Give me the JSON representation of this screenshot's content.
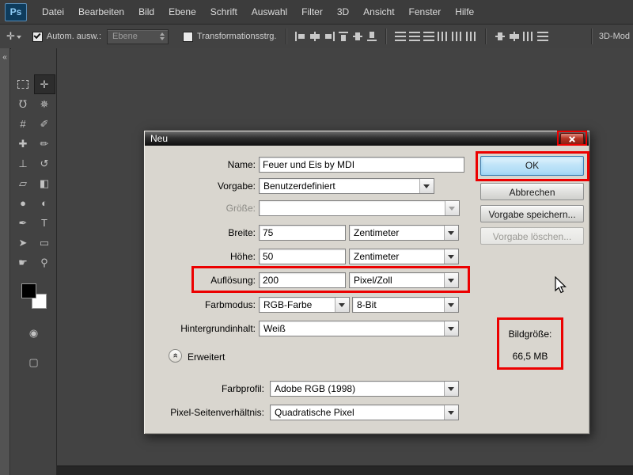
{
  "menubar": {
    "logo": "Ps",
    "items": [
      "Datei",
      "Bearbeiten",
      "Bild",
      "Ebene",
      "Schrift",
      "Auswahl",
      "Filter",
      "3D",
      "Ansicht",
      "Fenster",
      "Hilfe"
    ]
  },
  "optionsbar": {
    "tool_glyph": "✛",
    "auto_select_label": "Autom. ausw.:",
    "auto_select_value": "Ebene",
    "transform_label": "Transformationsstrg.",
    "workspace_label": "3D-Mod"
  },
  "toolbar": {
    "collapse_glyph": "«",
    "tools": [
      {
        "name": "rectangular-marquee",
        "glyph": "",
        "dashed": true
      },
      {
        "name": "move",
        "glyph": "✛",
        "selected": true
      },
      {
        "name": "lasso",
        "glyph": "℧"
      },
      {
        "name": "quick-selection",
        "glyph": "✵"
      },
      {
        "name": "crop",
        "glyph": "#"
      },
      {
        "name": "eyedropper",
        "glyph": "✐"
      },
      {
        "name": "healing-brush",
        "glyph": "✚"
      },
      {
        "name": "brush",
        "glyph": "✏"
      },
      {
        "name": "clone-stamp",
        "glyph": "⊥"
      },
      {
        "name": "history-brush",
        "glyph": "↺"
      },
      {
        "name": "eraser",
        "glyph": "▱"
      },
      {
        "name": "gradient",
        "glyph": "◧"
      },
      {
        "name": "blur",
        "glyph": "●"
      },
      {
        "name": "dodge",
        "glyph": "◐"
      },
      {
        "name": "pen",
        "glyph": "✒"
      },
      {
        "name": "type",
        "glyph": "T"
      },
      {
        "name": "path-selection",
        "glyph": "➤"
      },
      {
        "name": "shape",
        "glyph": "▭"
      },
      {
        "name": "hand",
        "glyph": "☛"
      },
      {
        "name": "zoom",
        "glyph": "⚲"
      }
    ],
    "extra_tools": [
      {
        "name": "quick-mask",
        "glyph": "◉"
      },
      {
        "name": "screen-mode",
        "glyph": "▢"
      }
    ]
  },
  "dialog": {
    "title": "Neu",
    "name_label": "Name:",
    "name_value": "Feuer und Eis by MDI",
    "preset_label": "Vorgabe:",
    "preset_value": "Benutzerdefiniert",
    "size_label": "Größe:",
    "width_label": "Breite:",
    "width_value": "75",
    "width_unit": "Zentimeter",
    "height_label": "Höhe:",
    "height_value": "50",
    "height_unit": "Zentimeter",
    "resolution_label": "Auflösung:",
    "resolution_value": "200",
    "resolution_unit": "Pixel/Zoll",
    "mode_label": "Farbmodus:",
    "mode_value": "RGB-Farbe",
    "depth_value": "8-Bit",
    "background_label": "Hintergrundinhalt:",
    "background_value": "Weiß",
    "advanced_label": "Erweitert",
    "advanced_glyph": "«",
    "profile_label": "Farbprofil:",
    "profile_value": "Adobe RGB (1998)",
    "aspect_label": "Pixel-Seitenverhältnis:",
    "aspect_value": "Quadratische Pixel",
    "ok_label": "OK",
    "cancel_label": "Abbrechen",
    "save_preset_label": "Vorgabe speichern...",
    "delete_preset_label": "Vorgabe löschen...",
    "image_size_label": "Bildgröße:",
    "image_size_value": "66,5 MB"
  },
  "annotation_color": "#ec0000"
}
